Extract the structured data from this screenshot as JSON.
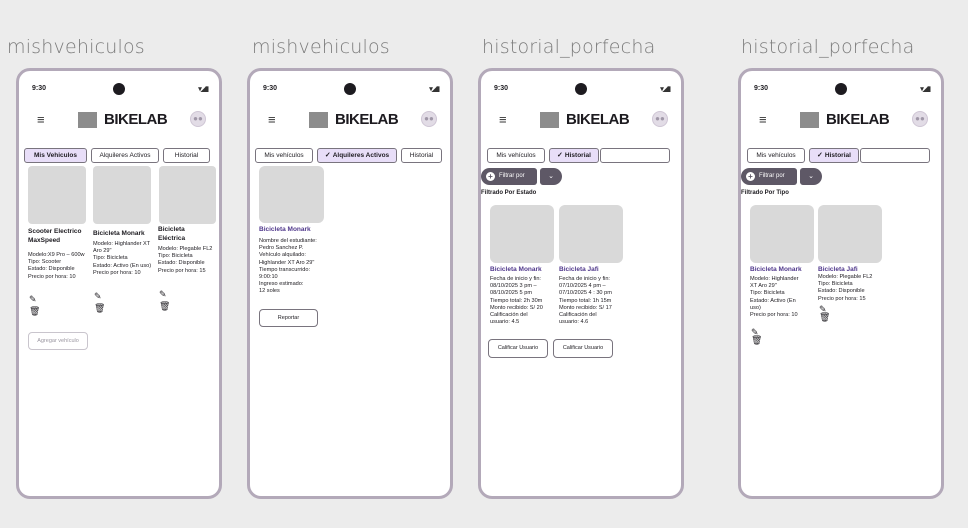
{
  "frames": [
    {
      "title": "mishvehiculos"
    },
    {
      "title": "mishvehiculos"
    },
    {
      "title": "historial_porfecha"
    },
    {
      "title": "historial_porfecha"
    }
  ],
  "status": {
    "time": "9:30"
  },
  "appbar": {
    "brand": "BIKELAB",
    "menu_icon": "≡"
  },
  "screen1": {
    "tabs": [
      "Mis Vehiculos",
      "Alquileres Activos",
      "Historial"
    ],
    "cards": [
      {
        "title": "Scooter Electrico MaxSpeed",
        "body": "Modelo:X9 Pro – 600w\nTipo: Scooter\nEstado: Disponible\nPrecio por hora: 10"
      },
      {
        "title": "Bicicleta Monark",
        "body": "Modelo: Highlander XT Aro 29\"\nTipo: Bicicleta\nEstado: Activo (En uso)\nPrecio por hora: 10"
      },
      {
        "title": "Bicicleta Eléctrica",
        "body": "Modelo: Plegable FL2\nTipo: Bicicleta\nEstado: Disponible\nPrecio por hora: 15"
      }
    ],
    "add_button": "Agregar vehículo"
  },
  "screen2": {
    "tabs": [
      "Mis vehículos",
      "Alquileres Activos",
      "Historial"
    ],
    "card": {
      "title": "Bicicleta Monark",
      "body": "Nombre del estudiante:\nPedro Sanchez P.\nVehículo alquilado:\n Highlander XT Aro 29\"\nTiempo transcurrido:\n9:00:10\nIngreso estimado:\n12 soles"
    },
    "report_button": "Reportar"
  },
  "screen3": {
    "tabs": [
      "Mis vehículos",
      "Historial",
      ""
    ],
    "filter_label": "Filtrar por",
    "section_label": "Filtrado Por Estado",
    "cards": [
      {
        "title": "Bicicleta Monark",
        "body": "Fecha de inicio y fin:\n08/10/2025 3 pm –\n08/10/2025 5 pm\n Tiempo total: 2h 30m\n Monto recibido: S/ 20\n Calificación del\nusuario: 4.5"
      },
      {
        "title": "Bicicleta Jafi",
        "body": "Fecha de inicio y fin:\n07/10/2025  4 pm –\n07/10/2025 4 : 30 pm\n Tiempo total: 1h 15m\n Monto recibido: S/ 17\n Calificación del\nusuario:  4.6"
      }
    ],
    "rate_button": "Calificar Usuario"
  },
  "screen4": {
    "tabs": [
      "Mis vehículos",
      "Historial",
      ""
    ],
    "filter_label": "Filtrar por",
    "section_label": "Filtrado Por Tipo",
    "cards": [
      {
        "title": "Bicicleta Monark",
        "body": "Modelo: Highlander\nXT Aro 29\"\nTipo: Bicicleta\nEstado: Activo (En\nuso)\nPrecio por hora: 10"
      },
      {
        "title": "Bicicleta Jafi",
        "body": "Modelo: Plegable FL2\nTipo: Bicicleta\nEstado: Disponible\nPrecio por hora: 15"
      }
    ]
  },
  "icons": {
    "edit": "edit-icon",
    "delete": "trash-icon",
    "check": "check-icon",
    "plus": "plus-circle-icon",
    "dropdown": "chevron-down-icon"
  },
  "colors": {
    "accent": "#e8def8",
    "brand_text": "#4f378b",
    "chip": "#5e5866",
    "frame": "#b3a9b9"
  }
}
